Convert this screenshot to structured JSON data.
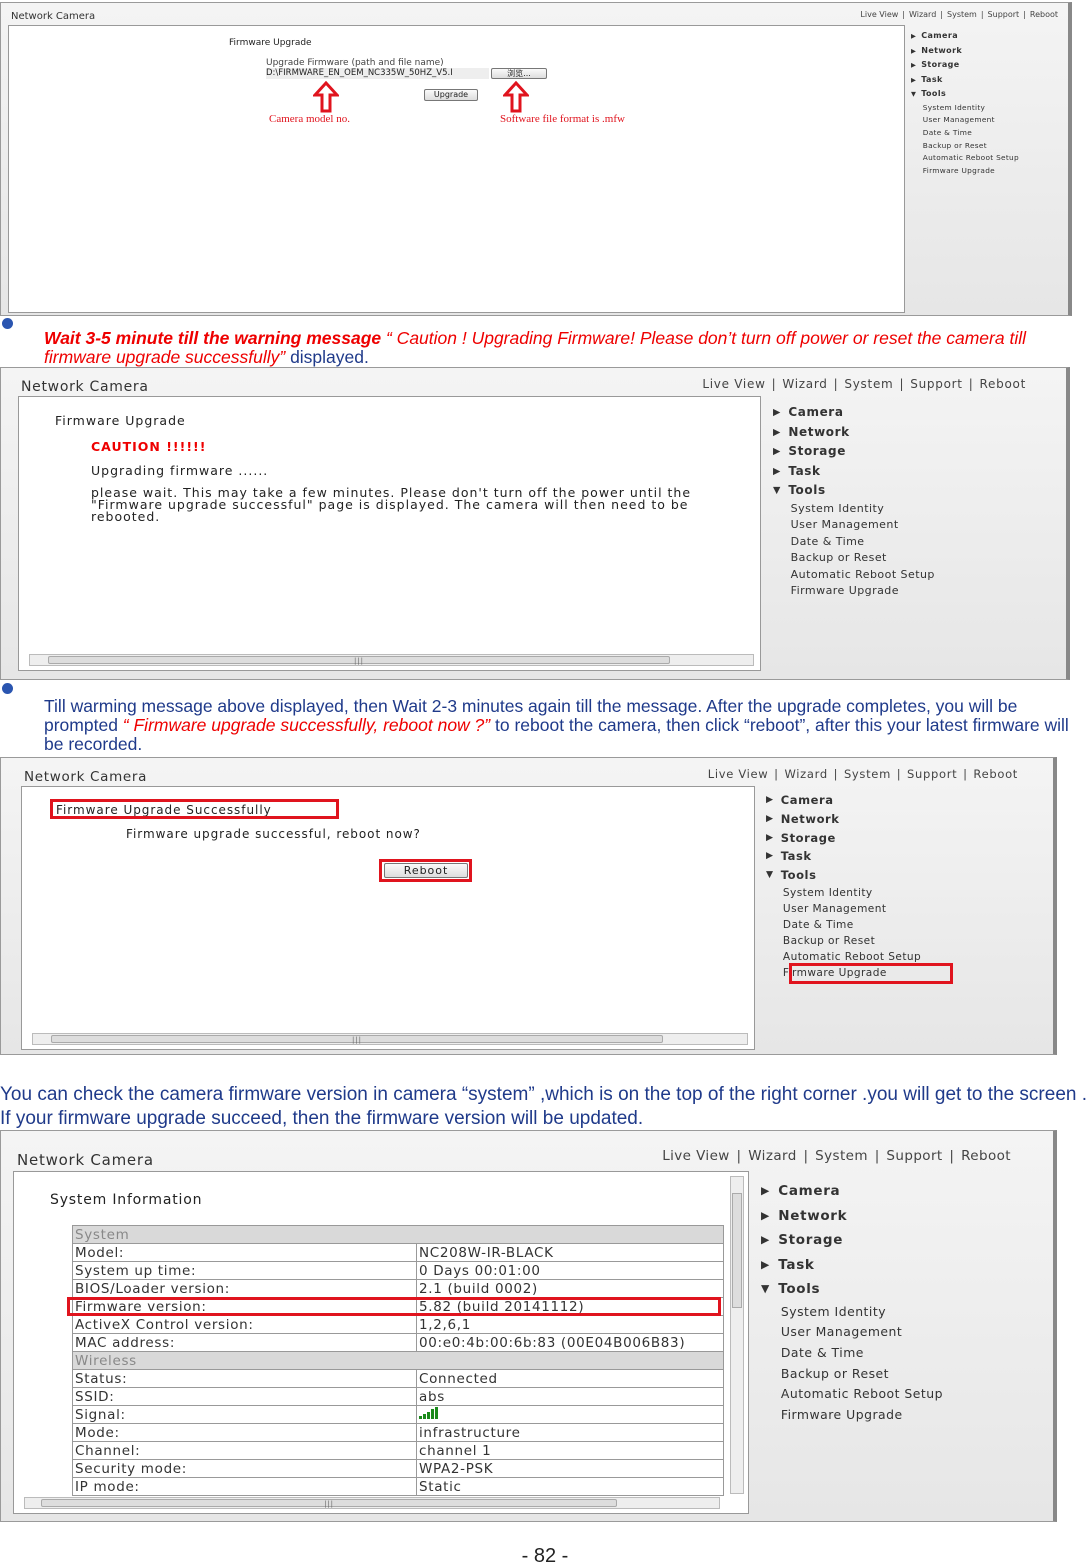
{
  "app_title": "Network Camera",
  "nav": [
    "Live View",
    "Wizard",
    "System",
    "Support",
    "Reboot"
  ],
  "sidebar": {
    "main": [
      "Camera",
      "Network",
      "Storage",
      "Task",
      "Tools"
    ],
    "tools": [
      "System Identity",
      "User Management",
      "Date & Time",
      "Backup or Reset",
      "Automatic Reboot Setup",
      "Firmware Upgrade"
    ]
  },
  "panel1": {
    "heading": "Firmware Upgrade",
    "field_label": "Upgrade Firmware (path and file name)",
    "field_value": "D:\\FIRMWARE_EN_OEM_NC335W_50HZ_V5.I",
    "browse_label": "浏览...",
    "upgrade_label": "Upgrade",
    "annot_model": "Camera model no.",
    "annot_format": "Software file format is .mfw"
  },
  "text1": {
    "part1": "Wait 3-5 minute till the warning message",
    "part2": " “ Caution ! Upgrading Firmware! Please don’t turn off power or reset the camera till firmware upgrade successfully”",
    "part3": " displayed."
  },
  "panel2": {
    "heading": "Firmware Upgrade",
    "caution": "CAUTION !!!!!!",
    "upgrading": "Upgrading firmware ......",
    "message": "please wait. This may take a few minutes. Please don't turn off the power until the \"Firmware upgrade successful\" page is displayed. The camera will then need to be rebooted."
  },
  "text2": {
    "part1": "Till warming message above displayed, then Wait 2-3 minutes again till the message. After the upgrade completes, you will be prompted ",
    "part2": "“ Firmware upgrade successfully, reboot now ?”",
    "part3": " to reboot the camera, then click “reboot”, after this your latest firmware will be recorded."
  },
  "panel3": {
    "heading": "Firmware Upgrade Successfully",
    "message": "Firmware upgrade successful, reboot now?",
    "reboot_label": "Reboot"
  },
  "text3": "You can check the camera firmware version in camera “system” ,which is on the top of the right corner .you will get to the screen . If your firmware upgrade succeed, then the firmware version will be updated.",
  "panel4": {
    "heading": "System Information",
    "rows": [
      {
        "section": "System"
      },
      {
        "label": "Model:",
        "value": "NC208W-IR-BLACK"
      },
      {
        "label": "System up time:",
        "value": "0 Days 00:01:00"
      },
      {
        "label": "BIOS/Loader version:",
        "value": "2.1 (build 0002)"
      },
      {
        "label": "Firmware version:",
        "value": "5.82 (build 20141112)",
        "highlight": true
      },
      {
        "label": "ActiveX Control version:",
        "value": "1,2,6,1"
      },
      {
        "label": "MAC address:",
        "value": "00:e0:4b:00:6b:83 (00E04B006B83)"
      },
      {
        "section": "Wireless"
      },
      {
        "label": "Status:",
        "value": "Connected"
      },
      {
        "label": "SSID:",
        "value": "abs"
      },
      {
        "label": "Signal:",
        "value": "",
        "icon": "signal-bars-icon"
      },
      {
        "label": "Mode:",
        "value": "infrastructure"
      },
      {
        "label": "Channel:",
        "value": "channel 1"
      },
      {
        "label": "Security mode:",
        "value": "WPA2-PSK"
      },
      {
        "label": "IP mode:",
        "value": "Static"
      }
    ]
  },
  "page_number": "- 82 -",
  "colors": {
    "annotation_red": "#e0141e",
    "text_blue": "#1f3a8a",
    "signal_green": "#1a8a1a"
  }
}
